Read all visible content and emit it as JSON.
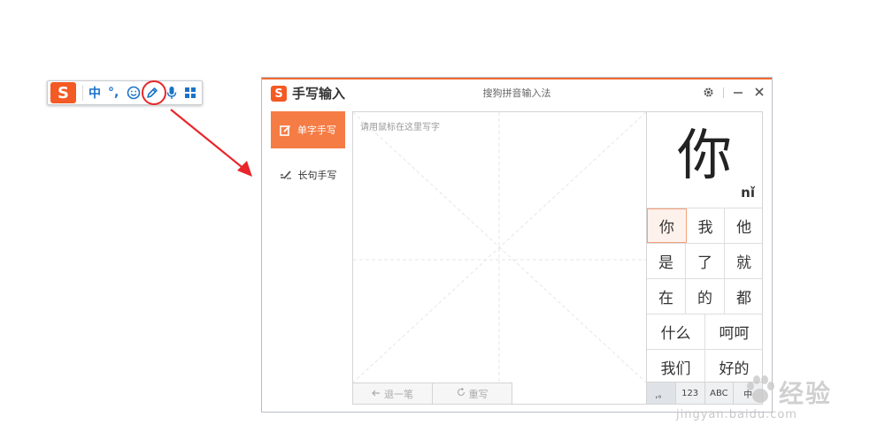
{
  "toolbar": {
    "logo_letter": "S",
    "lang_label": "中",
    "punct_label": "°,",
    "icons": [
      "smiley-icon",
      "handwriting-pen-icon",
      "microphone-icon",
      "toolbox-grid-icon"
    ]
  },
  "window": {
    "logo_letter": "S",
    "title": "手写输入",
    "app_name": "搜狗拼音输入法",
    "controls": [
      "gear-icon",
      "minimize-icon",
      "close-icon"
    ]
  },
  "sidebar": {
    "items": [
      {
        "label": "单字手写",
        "icon": "single-char-edit-icon",
        "active": true
      },
      {
        "label": "长句手写",
        "icon": "sentence-write-icon",
        "active": false
      }
    ]
  },
  "pad": {
    "placeholder": "请用鼠标在这里写字",
    "undo_label": "退一笔",
    "rewrite_label": "重写"
  },
  "candidates": {
    "preview_char": "你",
    "preview_pinyin": "nǐ",
    "rows": [
      [
        "你",
        "我",
        "他"
      ],
      [
        "是",
        "了",
        "就"
      ],
      [
        "在",
        "的",
        "都"
      ],
      [
        "什么",
        "呵呵"
      ],
      [
        "我们",
        "好的"
      ]
    ],
    "bottom_buttons": [
      ",。",
      "123",
      "ABC",
      "中"
    ]
  },
  "watermark": {
    "text": "经验",
    "url": "jingyan.baidu.com"
  },
  "colors": {
    "accent": "#f57c45",
    "brand": "#f35a24",
    "toolbar_blue": "#1a73c9",
    "annotation_red": "#e8262b"
  }
}
